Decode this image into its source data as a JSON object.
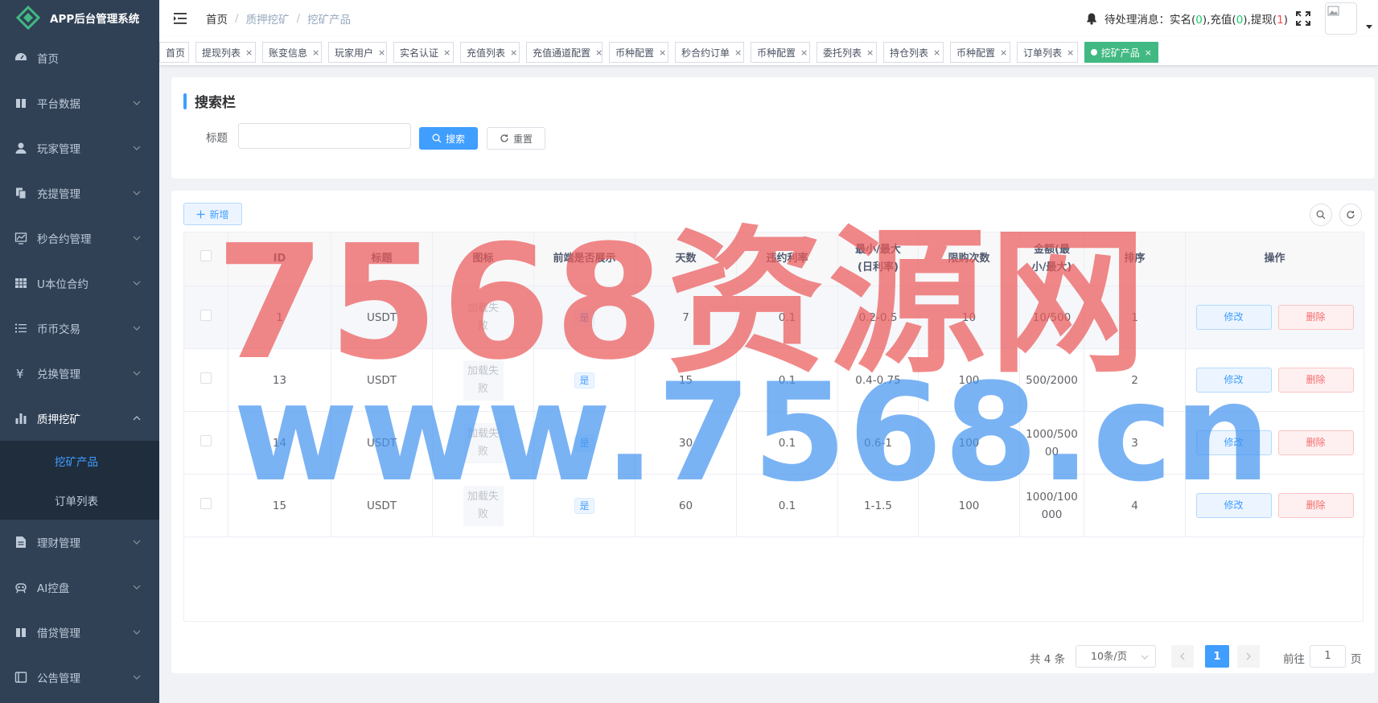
{
  "app": {
    "title": "APP后台管理系统"
  },
  "sidebar": {
    "items": [
      {
        "label": "首页",
        "icon": "dashboard-icon"
      },
      {
        "label": "平台数据",
        "icon": "book-icon"
      },
      {
        "label": "玩家管理",
        "icon": "user-icon"
      },
      {
        "label": "充提管理",
        "icon": "copy-icon"
      },
      {
        "label": "秒合约管理",
        "icon": "chart-icon"
      },
      {
        "label": "U本位合约",
        "icon": "grid-icon"
      },
      {
        "label": "币币交易",
        "icon": "list-icon"
      },
      {
        "label": "兑换管理",
        "icon": "yen-icon"
      },
      {
        "label": "质押挖矿",
        "icon": "bar-chart-icon"
      },
      {
        "label": "理财管理",
        "icon": "document-icon"
      },
      {
        "label": "AI控盘",
        "icon": "robot-icon"
      },
      {
        "label": "借贷管理",
        "icon": "book-icon"
      },
      {
        "label": "公告管理",
        "icon": "notice-icon"
      }
    ],
    "submenu": [
      {
        "label": "挖矿产品"
      },
      {
        "label": "订单列表"
      }
    ]
  },
  "navbar": {
    "breadcrumb": [
      "首页",
      "质押挖矿",
      "挖矿产品"
    ],
    "msg_prefix": "待处理消息：",
    "msg_realname_label": "实名(",
    "msg_realname_count": "0",
    "msg_recharge_label": "充值(",
    "msg_recharge_count": "0",
    "msg_withdraw_label": "提现(",
    "msg_withdraw_count": "1",
    "msg_close": ")",
    "msg_sep": "),"
  },
  "tags": [
    {
      "label": "首页"
    },
    {
      "label": "提现列表"
    },
    {
      "label": "账变信息"
    },
    {
      "label": "玩家用户"
    },
    {
      "label": "实名认证"
    },
    {
      "label": "充值列表"
    },
    {
      "label": "充值通道配置"
    },
    {
      "label": "币种配置"
    },
    {
      "label": "秒合约订单"
    },
    {
      "label": "币种配置"
    },
    {
      "label": "委托列表"
    },
    {
      "label": "持仓列表"
    },
    {
      "label": "币种配置"
    },
    {
      "label": "订单列表"
    },
    {
      "label": "挖矿产品"
    }
  ],
  "search": {
    "section_title": "搜索栏",
    "field_label": "标题",
    "field_value": "",
    "search_label": "搜索",
    "reset_label": "重置"
  },
  "table": {
    "add_label": "新增",
    "columns": [
      "ID",
      "标题",
      "图标",
      "前端是否展示",
      "天数",
      "违约利率",
      "最小/最大(日利率)",
      "限购次数",
      "金额(最小/最大)",
      "排序",
      "操作"
    ],
    "col_min_max_line1": "最小/最大",
    "col_min_max_line2": "(日利率)",
    "col_amount_line1": "金额(最",
    "col_amount_line2": "小/最大)",
    "rows": [
      {
        "id": "1",
        "title": "USDT",
        "icon_err": "加载失败",
        "show": "是",
        "days": "7",
        "penalty": "0.1",
        "rate": "0.2-0.5",
        "limit": "10",
        "amount_line1": "10/500",
        "amount_line2": "",
        "sort": "1"
      },
      {
        "id": "13",
        "title": "USDT",
        "icon_err": "加载失败",
        "show": "是",
        "days": "15",
        "penalty": "0.1",
        "rate": "0.4-0.75",
        "limit": "100",
        "amount_line1": "500/2000",
        "amount_line2": "",
        "sort": "2"
      },
      {
        "id": "14",
        "title": "USDT",
        "icon_err": "加载失败",
        "show": "是",
        "days": "30",
        "penalty": "0.1",
        "rate": "0.6-1",
        "limit": "100",
        "amount_line1": "1000/500",
        "amount_line2": "00",
        "sort": "3"
      },
      {
        "id": "15",
        "title": "USDT",
        "icon_err": "加载失败",
        "show": "是",
        "days": "60",
        "penalty": "0.1",
        "rate": "1-1.5",
        "limit": "100",
        "amount_line1": "1000/100",
        "amount_line2": "000",
        "sort": "4"
      }
    ],
    "edit_label": "修改",
    "delete_label": "删除"
  },
  "pagination": {
    "total": "共 4 条",
    "page_size": "10条/页",
    "current": "1",
    "goto_label": "前往",
    "goto_value": "1",
    "goto_unit": "页"
  },
  "watermark": {
    "line1": "7568资源网",
    "line2": "www.7568.cn"
  },
  "colors": {
    "sidebar": "#304156",
    "submenu": "#1f2d3d",
    "primary": "#409eff",
    "active_tag": "#42b983",
    "danger": "#f56c6c"
  }
}
